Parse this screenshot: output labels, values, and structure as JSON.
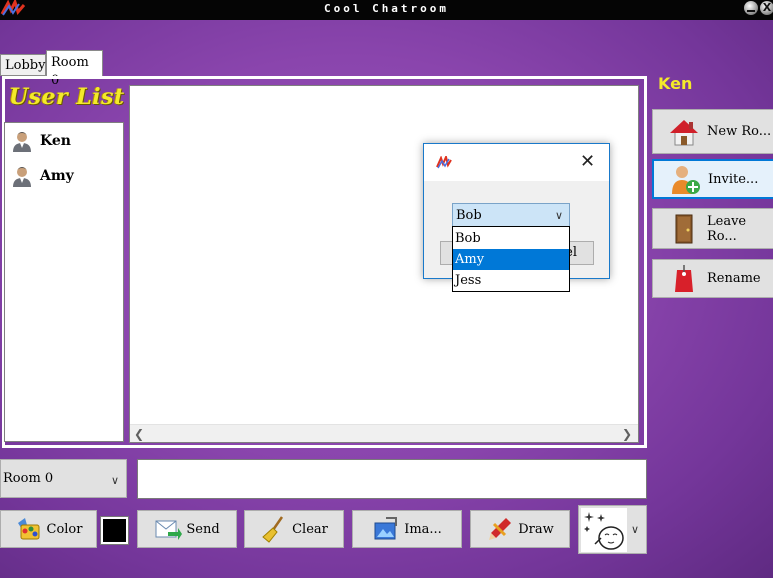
{
  "window": {
    "title": "Cool Chatroom",
    "close_glyph": "X"
  },
  "tabs": [
    {
      "label": "Lobby"
    },
    {
      "label": "Room 0"
    }
  ],
  "user_list": {
    "title": "User List",
    "users": [
      {
        "name": "Ken",
        "icon": "user-icon"
      },
      {
        "name": "Amy",
        "icon": "user-icon"
      }
    ]
  },
  "side_panel": {
    "current_user": "Ken",
    "buttons": [
      {
        "label": "New Ro...",
        "icon": "house-icon"
      },
      {
        "label": "Invite...",
        "icon": "add-user-icon"
      },
      {
        "label": "Leave Ro...",
        "icon": "door-icon"
      },
      {
        "label": "Rename",
        "icon": "tag-icon"
      }
    ]
  },
  "bottom": {
    "room_select": {
      "value": "Room 0"
    },
    "message_input": {
      "value": ""
    },
    "color_label": "Color",
    "selected_color": "#000000",
    "send_label": "Send",
    "clear_label": "Clear",
    "image_label": "Ima...",
    "draw_label": "Draw"
  },
  "dialog": {
    "combo_value": "Bob",
    "options": [
      {
        "label": "Bob"
      },
      {
        "label": "Amy"
      },
      {
        "label": "Jess"
      }
    ],
    "highlighted_option": "Amy",
    "cancel_label_visible": "el",
    "close_glyph": "✕"
  },
  "colors": {
    "accent_yellow": "#f4ea2a",
    "selection_blue": "#0078d7",
    "background_purple": "#8a45ad"
  }
}
